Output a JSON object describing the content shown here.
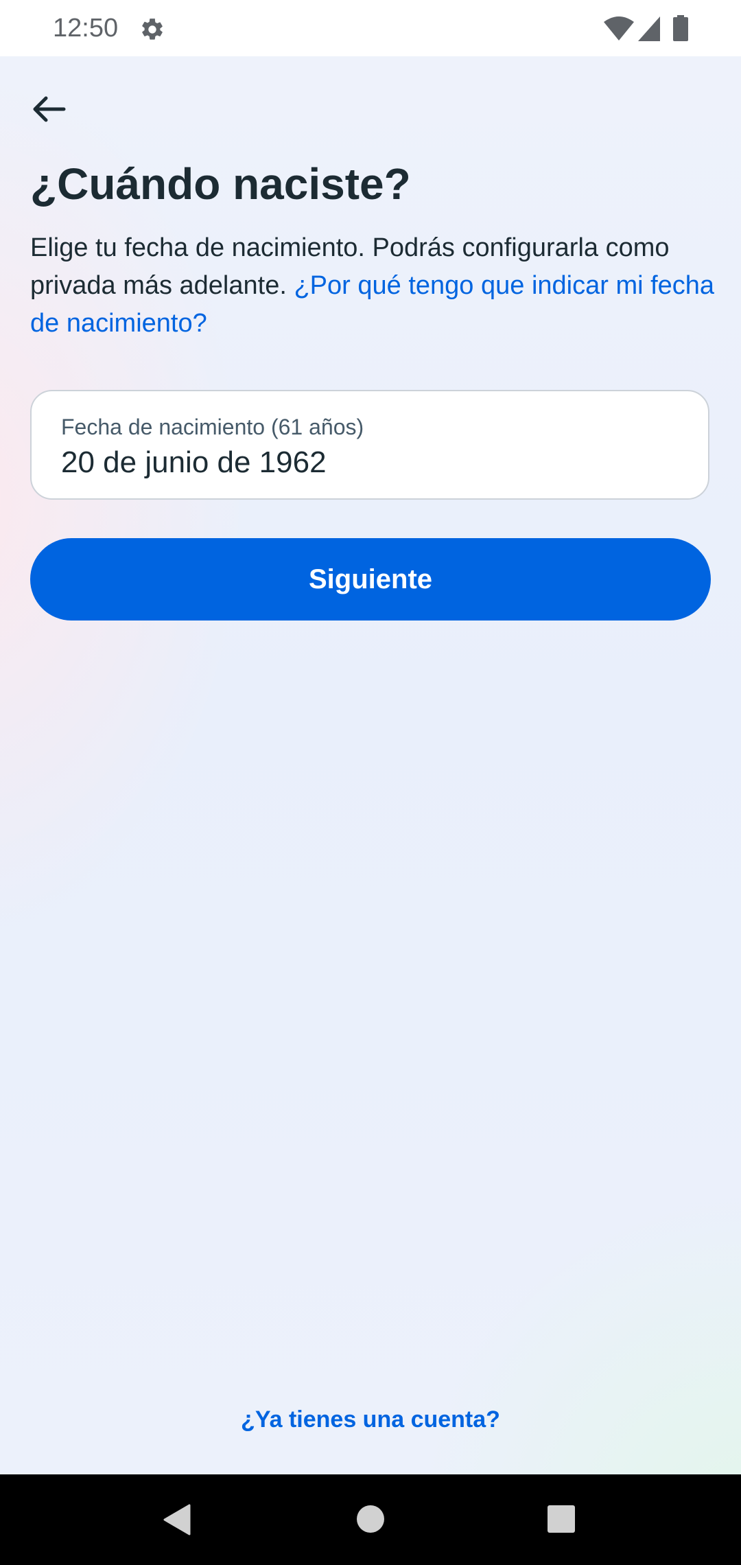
{
  "status_bar": {
    "time": "12:50",
    "icons": [
      "gear-icon",
      "wifi-icon",
      "cell-signal-icon",
      "battery-icon"
    ]
  },
  "header": {
    "back_icon": "arrow-left-icon"
  },
  "main": {
    "title": "¿Cuándo naciste?",
    "description": "Elige tu fecha de nacimiento. Podrás configurarla como privada más adelante.",
    "help_link": "¿Por qué tengo que indicar mi fecha de nacimiento?",
    "birthdate_field": {
      "label": "Fecha de nacimiento (61 años)",
      "value": "20 de junio de 1962"
    },
    "next_button": "Siguiente"
  },
  "footer": {
    "login_link": "¿Ya tienes una cuenta?"
  },
  "nav_bar": {
    "icons": [
      "nav-back-icon",
      "nav-home-icon",
      "nav-recents-icon"
    ]
  },
  "colors": {
    "accent": "#0064e0",
    "text_primary": "#1c2b33",
    "field_border": "#ccd2d9"
  }
}
